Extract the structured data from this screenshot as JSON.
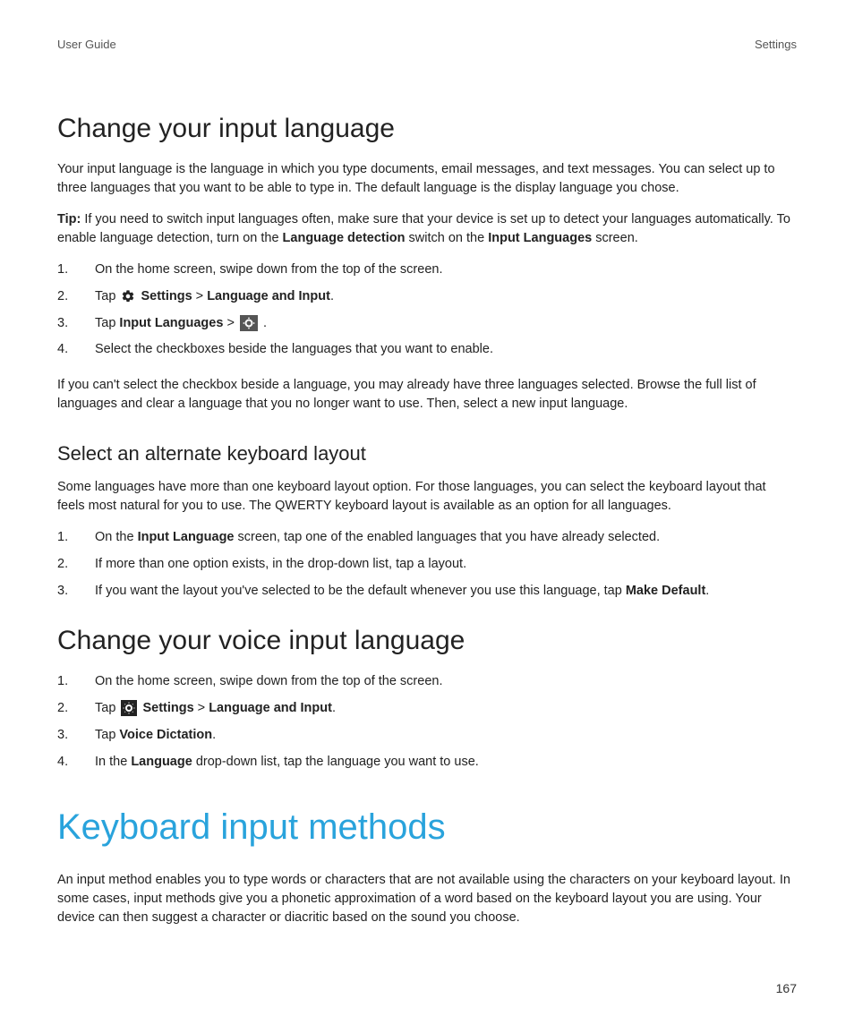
{
  "header": {
    "left": "User Guide",
    "right": "Settings"
  },
  "s1": {
    "title": "Change your input language",
    "p1": "Your input language is the language in which you type documents, email messages, and text messages. You can select up to three languages that you want to be able to type in. The default language is the display language you chose.",
    "tip_label": "Tip:",
    "tip_before": " If you need to switch input languages often, make sure that your device is set up to detect your languages automatically. To enable language detection, turn on the ",
    "tip_bold1": "Language detection",
    "tip_mid": " switch on the ",
    "tip_bold2": "Input Languages",
    "tip_after": " screen.",
    "step1": "On the home screen, swipe down from the top of the screen.",
    "step2_a": "Tap ",
    "step2_b": "Settings",
    "step2_c": " > ",
    "step2_d": "Language and Input",
    "step2_e": ".",
    "step3_a": "Tap ",
    "step3_b": "Input Languages",
    "step3_c": " > ",
    "step3_d": " .",
    "step4": "Select the checkboxes beside the languages that you want to enable.",
    "p2": "If you can't select the checkbox beside a language, you may already have three languages selected. Browse the full list of languages and clear a language that you no longer want to use. Then, select a new input language."
  },
  "s2": {
    "title": "Select an alternate keyboard layout",
    "p1": "Some languages have more than one keyboard layout option. For those languages, you can select the keyboard layout that feels most natural for you to use. The QWERTY keyboard layout is available as an option for all languages.",
    "step1_a": "On the ",
    "step1_b": "Input Language",
    "step1_c": " screen, tap one of the enabled languages that you have already selected.",
    "step2": "If more than one option exists, in the drop-down list, tap a layout.",
    "step3_a": "If you want the layout you've selected to be the default whenever you use this language, tap ",
    "step3_b": "Make Default",
    "step3_c": "."
  },
  "s3": {
    "title": "Change your voice input language",
    "step1": "On the home screen, swipe down from the top of the screen.",
    "step2_a": "Tap ",
    "step2_b": "Settings",
    "step2_c": " > ",
    "step2_d": "Language and Input",
    "step2_e": ".",
    "step3_a": "Tap ",
    "step3_b": "Voice Dictation",
    "step3_c": ".",
    "step4_a": "In the ",
    "step4_b": "Language",
    "step4_c": " drop-down list, tap the language you want to use."
  },
  "chapter": {
    "title": "Keyboard input methods",
    "p1": "An input method enables you to type words or characters that are not available using the characters on your keyboard layout. In some cases, input methods give you a phonetic approximation of a word based on the keyboard layout you are using. Your device can then suggest a character or diacritic based on the sound you choose."
  },
  "footer": {
    "page": "167"
  }
}
